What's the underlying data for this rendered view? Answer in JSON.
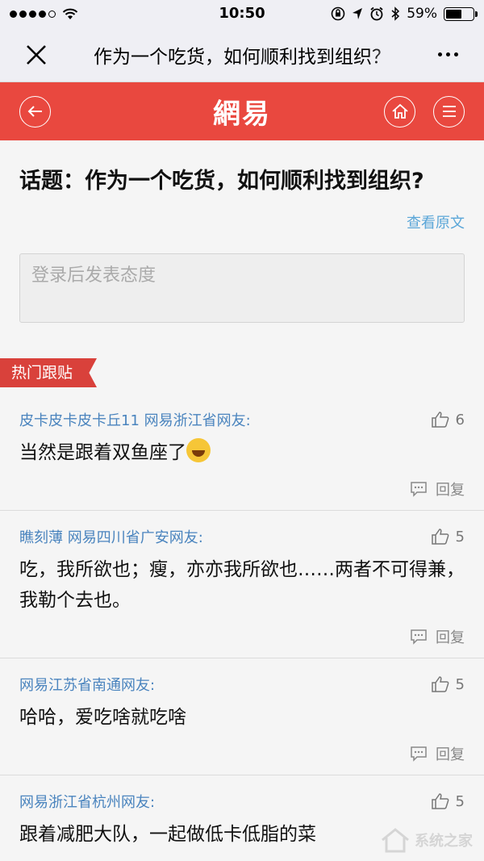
{
  "status": {
    "time": "10:50",
    "battery": "59%",
    "battery_level": 0.59
  },
  "titlebar": {
    "title": "作为一个吃货，如何顺利找到组织？"
  },
  "header": {
    "logo": "網易"
  },
  "topic": {
    "title": "话题：作为一个吃货，如何顺利找到组织?",
    "view_original": "查看原文"
  },
  "comment_box": {
    "placeholder": "登录后发表态度"
  },
  "hot_section": {
    "label": "热门跟贴"
  },
  "comments": [
    {
      "author": "皮卡皮卡皮卡丘11 网易浙江省网友:",
      "likes": "6",
      "text": "当然是跟着双鱼座了",
      "reply": "回复"
    },
    {
      "author": "瞧刻薄 网易四川省广安网友:",
      "likes": "5",
      "text": "吃，我所欲也；瘦，亦亦我所欲也……两者不可得兼，我勒个去也。",
      "reply": "回复"
    },
    {
      "author": "网易江苏省南通网友:",
      "likes": "5",
      "text": "哈哈，爱吃啥就吃啥",
      "reply": "回复"
    },
    {
      "author": "网易浙江省杭州网友:",
      "likes": "5",
      "text": "跟着减肥大队，一起做低卡低脂的菜",
      "reply": ""
    }
  ],
  "watermark": {
    "text": "系统之家"
  },
  "colors": {
    "brand_red": "#e9483f",
    "link_blue": "#4a84be"
  }
}
